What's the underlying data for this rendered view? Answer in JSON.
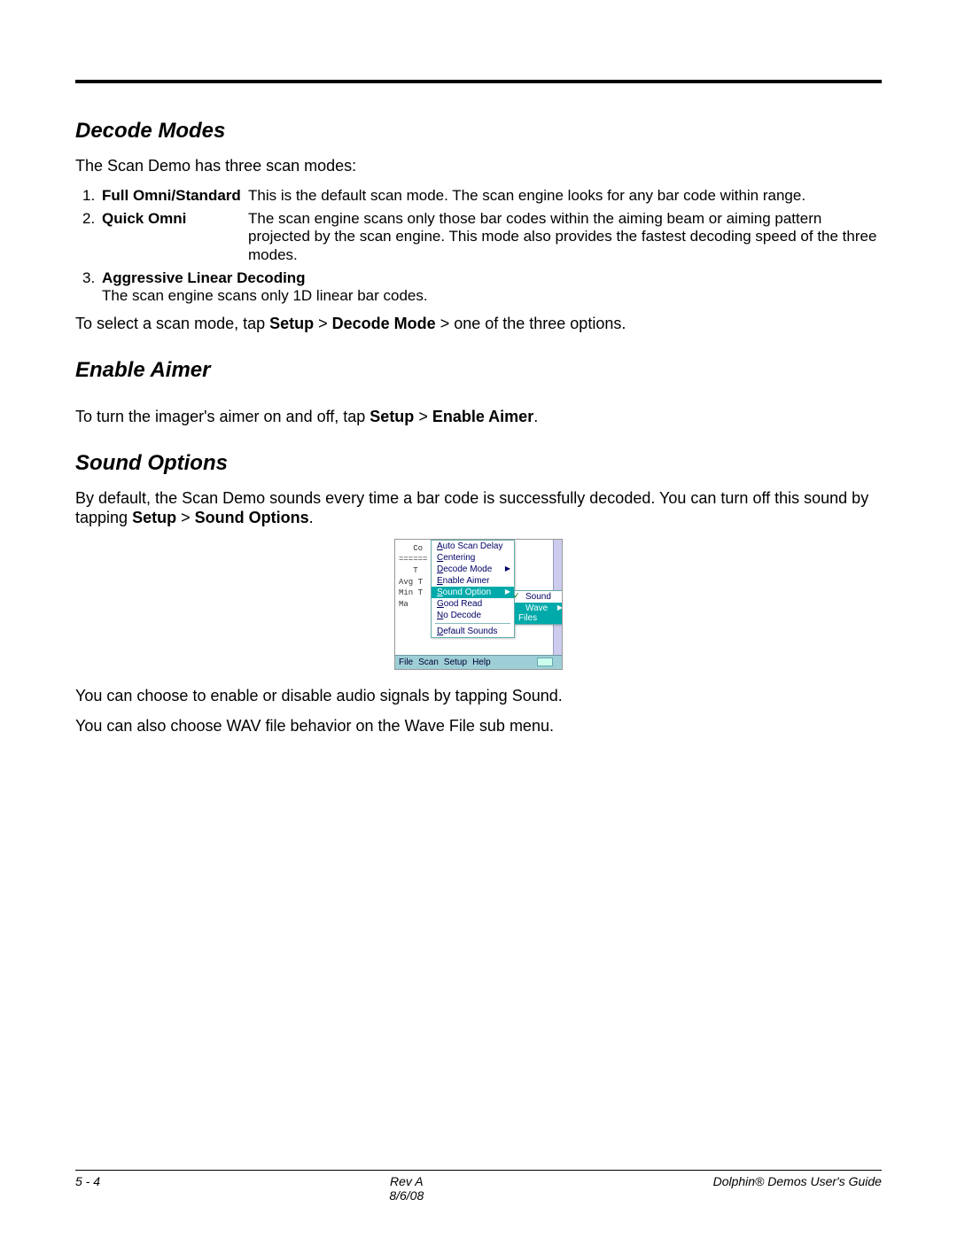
{
  "sections": {
    "decode": {
      "title": "Decode Modes",
      "intro": "The Scan Demo has three scan modes:",
      "items": [
        {
          "num": "1.",
          "term": "Full Omni/Standard",
          "desc": "This is the default scan mode. The scan engine looks for any bar code within range."
        },
        {
          "num": "2.",
          "term": "Quick Omni",
          "desc": "The scan engine scans only those bar codes within the aiming beam or aiming pattern projected by the scan engine. This mode also provides the fastest decoding speed of the three modes."
        },
        {
          "num": "3.",
          "term": "Aggressive Linear Decoding",
          "desc": "The scan engine scans only 1D linear bar codes."
        }
      ],
      "instr_pre": "To select a scan mode, tap ",
      "instr_b1": "Setup",
      "instr_gt1": " > ",
      "instr_b2": "Decode Mode",
      "instr_gt2": " > one of the three options."
    },
    "aimer": {
      "title": "Enable Aimer",
      "instr_pre": "To turn the imager's aimer on and off, tap ",
      "instr_b1": "Setup",
      "instr_gt1": " > ",
      "instr_b2": "Enable Aimer",
      "instr_end": "."
    },
    "sound": {
      "title": "Sound Options",
      "p1_pre": "By default, the Scan Demo sounds every time a bar code is successfully decoded. You can turn off this sound by tapping ",
      "p1_b1": "Setup",
      "p1_gt": " > ",
      "p1_b2": "Sound Options",
      "p1_end": ".",
      "p2": "You can choose to enable or disable audio signals by tapping Sound.",
      "p3": "You can also choose WAV file behavior on the Wave File sub menu."
    }
  },
  "screenshot": {
    "bg_lines": [
      "   Co",
      "======",
      "   T",
      "Avg T",
      "Min T",
      "Ma"
    ],
    "menu": {
      "items": [
        {
          "label": "Auto Scan Delay",
          "u": "A"
        },
        {
          "label": "Centering",
          "u": "C"
        },
        {
          "label": "Decode Mode",
          "u": "D",
          "arrow": true
        },
        {
          "label": "Enable Aimer",
          "u": "E"
        },
        {
          "label": "Sound Option",
          "u": "S",
          "hl": true,
          "arrow": true
        },
        {
          "label": "Good Read",
          "u": "G"
        },
        {
          "label": "No Decode",
          "u": "N"
        },
        {
          "sep": true
        },
        {
          "label": "Default Sounds",
          "u": "D"
        }
      ]
    },
    "submenu": {
      "items": [
        {
          "label": "Sound",
          "u": "S",
          "check": true
        },
        {
          "label": "Wave Files",
          "u": "W",
          "hl": true,
          "arrow": true
        }
      ]
    },
    "bottombar": [
      "File",
      "Scan",
      "Setup",
      "Help"
    ]
  },
  "footer": {
    "left": "5 - 4",
    "mid1": "Rev A",
    "mid2": "8/6/08",
    "right": "Dolphin® Demos User's Guide"
  }
}
